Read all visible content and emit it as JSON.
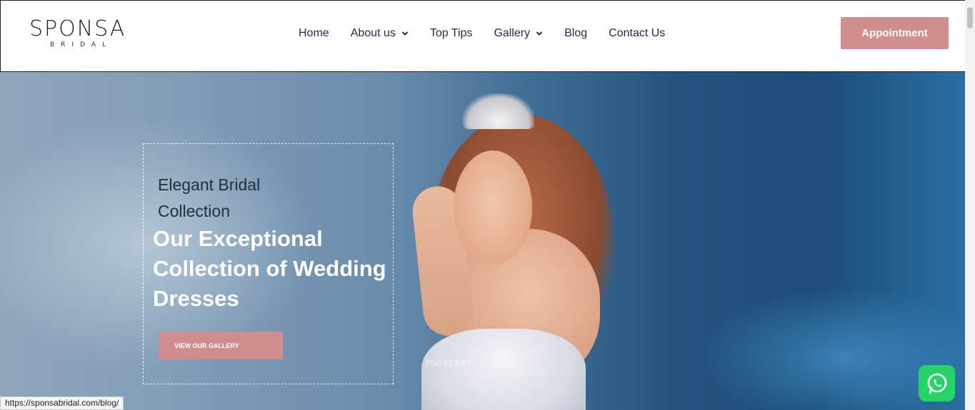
{
  "brand": {
    "name": "SPONSA",
    "sub": "BRIDAL",
    "accent": "#d18e8e"
  },
  "nav": {
    "items": [
      {
        "label": "Home",
        "has_dropdown": false
      },
      {
        "label": "About us",
        "has_dropdown": true
      },
      {
        "label": "Top Tips",
        "has_dropdown": false
      },
      {
        "label": "Gallery",
        "has_dropdown": true
      },
      {
        "label": "Blog",
        "has_dropdown": false
      },
      {
        "label": "Contact Us",
        "has_dropdown": false
      }
    ],
    "cta_label": "Appointment"
  },
  "hero": {
    "subtitle": "Elegant Bridal Collection",
    "headline": "Our Exceptional Collection of Wedding Dresses",
    "button_label": "VIEW OUR GALLERY",
    "watermark": "mostaql"
  },
  "status_bar": {
    "url": "https://sponsabridal.com/blog/"
  },
  "icons": {
    "chevron": "chevron-down-icon",
    "whatsapp": "whatsapp-icon"
  }
}
